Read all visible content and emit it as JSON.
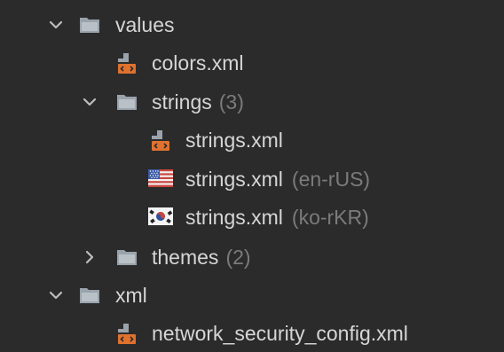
{
  "project_tree": {
    "rows": [
      {
        "label": "values",
        "type": "folder",
        "state": "expanded",
        "icon": "folder-icon"
      },
      {
        "label": "colors.xml",
        "type": "file",
        "icon": "xml-file-icon"
      },
      {
        "label": "strings",
        "count": "(3)",
        "type": "folder",
        "state": "expanded",
        "icon": "folder-icon"
      },
      {
        "label": "strings.xml",
        "type": "file",
        "icon": "xml-file-icon"
      },
      {
        "label": "strings.xml",
        "qualifier": "(en-rUS)",
        "type": "file",
        "icon": "us-flag-icon"
      },
      {
        "label": "strings.xml",
        "qualifier": "(ko-rKR)",
        "type": "file",
        "icon": "korea-flag-icon"
      },
      {
        "label": "themes",
        "count": "(2)",
        "type": "folder",
        "state": "collapsed",
        "icon": "folder-icon"
      },
      {
        "label": "xml",
        "type": "folder",
        "state": "expanded",
        "icon": "folder-icon"
      },
      {
        "label": "network_security_config.xml",
        "type": "file",
        "icon": "xml-file-icon"
      }
    ]
  },
  "colors": {
    "background": "#2b2b2b",
    "text": "#d6d6d6",
    "muted_text": "#7b7b7b",
    "folder_icon": "#9aa3ab",
    "xml_icon_accent": "#e0712e"
  }
}
